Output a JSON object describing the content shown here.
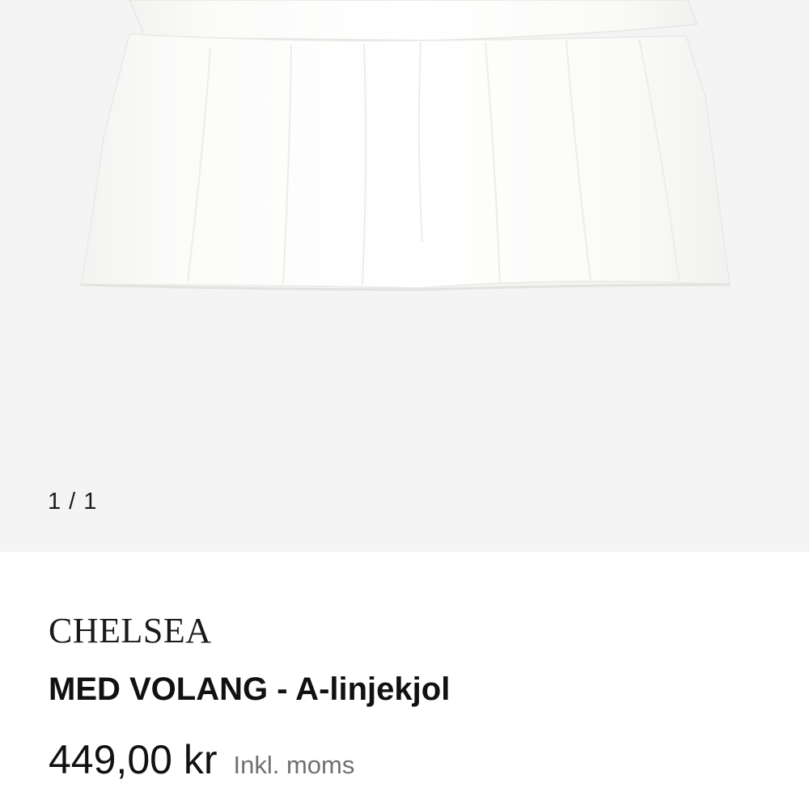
{
  "gallery": {
    "image_name": "white-tiered-skirt-photo",
    "counter": "1 / 1"
  },
  "product": {
    "brand": "CHELSEA",
    "name": "MED VOLANG - A-linjekjol",
    "price": "449,00 kr",
    "vat_note": "Inkl. moms"
  },
  "colors": {
    "gallery_bg": "#f4f4f4",
    "text": "#111111",
    "muted": "#707070"
  }
}
